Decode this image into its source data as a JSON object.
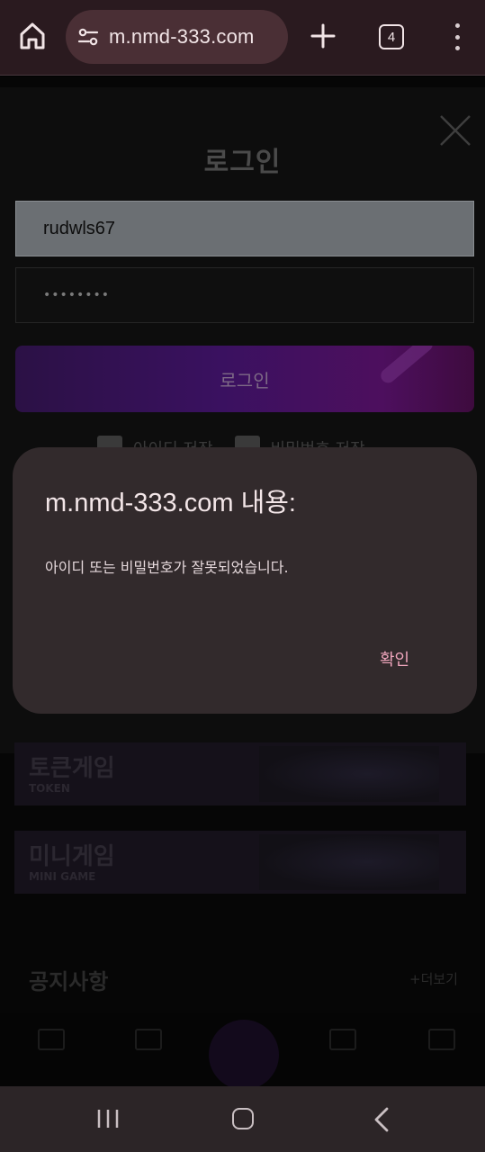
{
  "browser": {
    "url": "m.nmd-333.com",
    "tab_count": "4"
  },
  "login": {
    "title": "로그인",
    "username_value": "rudwls67",
    "password_mask": "••••••••",
    "submit_label": "로그인",
    "remember_id_label": "아이디 저장",
    "remember_pw_label": "비밀번호 저장"
  },
  "banners": [
    {
      "title": "토큰게임",
      "subtitle": "TOKEN"
    },
    {
      "title": "미니게임",
      "subtitle": "MINI GAME"
    }
  ],
  "notice": {
    "title": "공지사항",
    "more_label": "+더보기"
  },
  "dialog": {
    "title": "m.nmd-333.com 내용:",
    "message": "아이디 또는 비밀번호가 잘못되었습니다.",
    "confirm_label": "확인"
  },
  "colors": {
    "browser_bar": "#2a1a1f",
    "url_pill": "#4a2f35",
    "dialog_bg": "#322a2c",
    "dialog_accent": "#f0a6bd",
    "login_button": "#3a1160"
  },
  "icons": [
    "home-icon",
    "site-settings-icon",
    "plus-icon",
    "tab-switcher-icon",
    "more-vert-icon",
    "close-icon",
    "recent-apps-icon",
    "home-nav-icon",
    "back-icon"
  ]
}
